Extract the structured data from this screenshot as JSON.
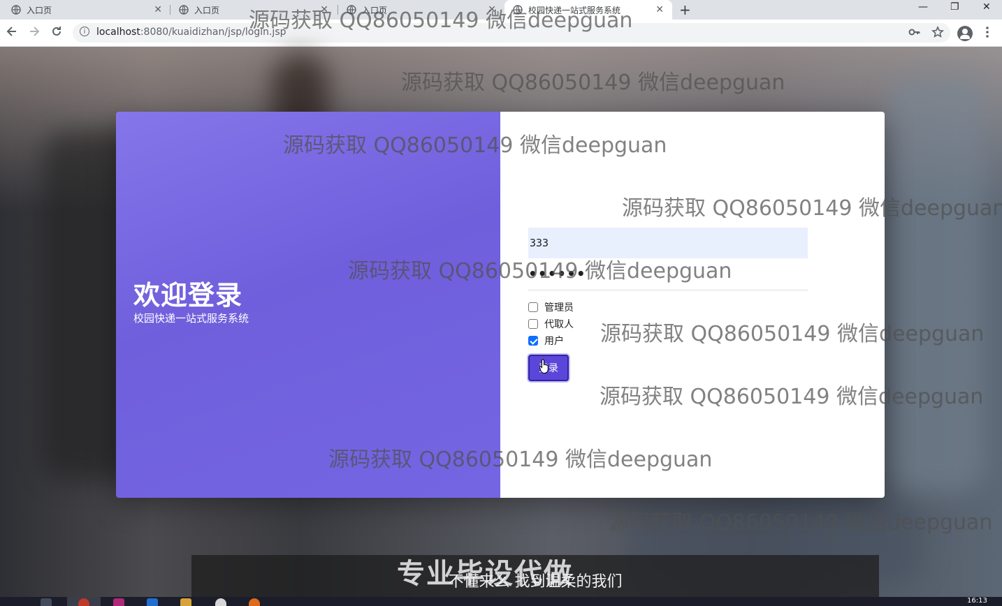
{
  "browser": {
    "tabs": [
      {
        "title": "入口页"
      },
      {
        "title": "入口页"
      },
      {
        "title": "入口页"
      },
      {
        "title": "校园快递一站式服务系统"
      }
    ],
    "new_tab": "+",
    "url_host": "localhost",
    "url_path": ":8080/kuaidizhan/jsp/login.jsp",
    "window_controls": {
      "minimize": "—",
      "restore": "❐",
      "close": "✕"
    }
  },
  "login": {
    "welcome_title": "欢迎登录",
    "welcome_subtitle": "校园快递一站式服务系统",
    "username_value": "333",
    "password_mask": "••••••",
    "roles": [
      {
        "label": "管理员",
        "checked": false
      },
      {
        "label": "代取人",
        "checked": false
      },
      {
        "label": "用户",
        "checked": true
      }
    ],
    "login_button": "登录"
  },
  "watermark": "源码获取 QQ86050149 微信deepguan",
  "caption": {
    "big_text": "专业毕设代做",
    "subtitle": "不懂来么 找到温柔的我们"
  },
  "taskbar": {
    "clock": "16:13"
  },
  "colors": {
    "panel_purple": "#7466e3",
    "button_purple": "#5a46d8",
    "checkbox_blue": "#0d6efd",
    "autofill_blue": "#e8f0fe"
  }
}
